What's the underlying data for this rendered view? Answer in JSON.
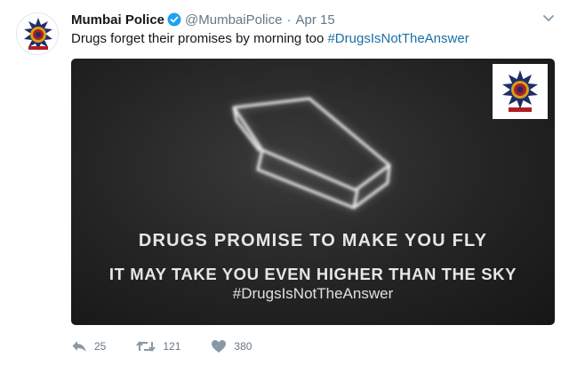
{
  "tweet": {
    "author_name": "Mumbai Police",
    "author_handle": "@MumbaiPolice",
    "separator": "·",
    "date": "Apr 15",
    "text": "Drugs forget their promises by morning too ",
    "hashtag": "#DrugsIsNotTheAnswer"
  },
  "image": {
    "headline": "DRUGS PROMISE TO MAKE YOU FLY",
    "subline": "IT MAY TAKE YOU EVEN HIGHER THAN THE SKY",
    "hashtag": "#DrugsIsNotTheAnswer"
  },
  "actions": {
    "reply_count": "25",
    "retweet_count": "121",
    "like_count": "380"
  },
  "colors": {
    "link": "#1b6fa3",
    "verified": "#1da1f2",
    "muted": "#657786"
  },
  "icons": [
    "police-emblem-avatar",
    "verified-badge-icon",
    "chevron-down-icon",
    "reply-icon",
    "retweet-icon",
    "heart-icon"
  ]
}
